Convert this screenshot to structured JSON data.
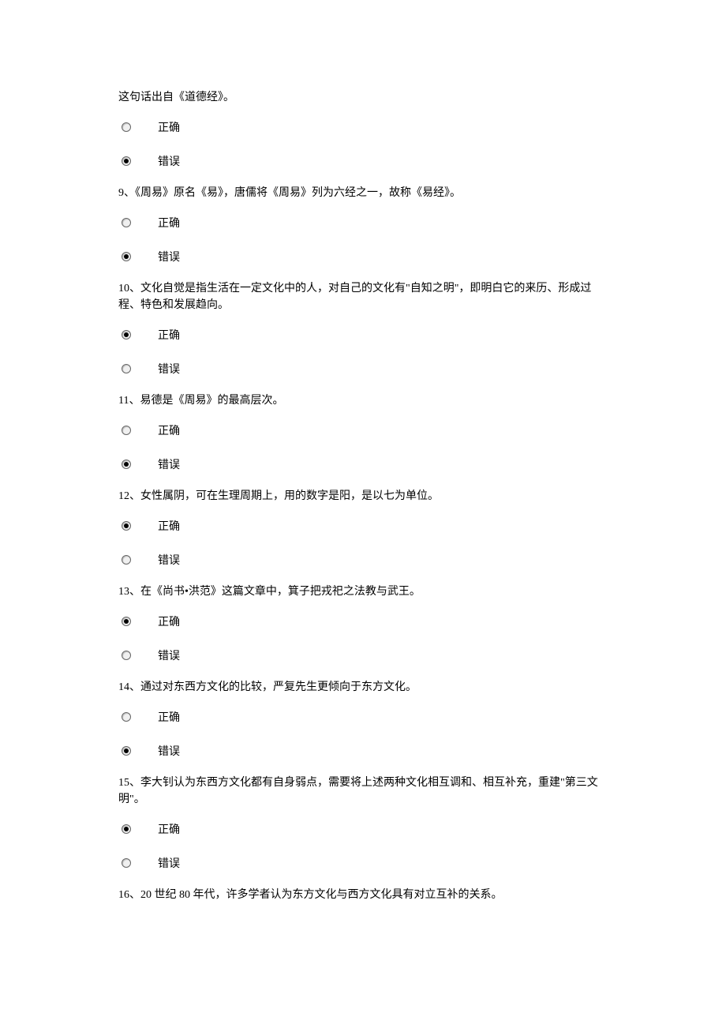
{
  "intro_text": "这句话出自《道德经》。",
  "labels": {
    "correct": "正确",
    "incorrect": "错误"
  },
  "questions": [
    {
      "id": "q8",
      "text": "",
      "selected": "incorrect"
    },
    {
      "id": "q9",
      "text": "9、《周易》原名《易》，唐儒将《周易》列为六经之一，故称《易经》。",
      "selected": "incorrect"
    },
    {
      "id": "q10",
      "text": "10、文化自觉是指生活在一定文化中的人，对自己的文化有\"自知之明\"，即明白它的来历、形成过程、特色和发展趋向。",
      "selected": "correct"
    },
    {
      "id": "q11",
      "text": "11、易德是《周易》的最高层次。",
      "selected": "incorrect"
    },
    {
      "id": "q12",
      "text": "12、女性属阴，可在生理周期上，用的数字是阳，是以七为单位。",
      "selected": "correct"
    },
    {
      "id": "q13",
      "text": "13、在《尚书•洪范》这篇文章中，箕子把戎祀之法教与武王。",
      "selected": "correct"
    },
    {
      "id": "q14",
      "text": "14、通过对东西方文化的比较，严复先生更倾向于东方文化。",
      "selected": "incorrect"
    },
    {
      "id": "q15",
      "text": "15、李大钊认为东西方文化都有自身弱点，需要将上述两种文化相互调和、相互补充，重建\"第三文明\"。",
      "selected": "correct"
    },
    {
      "id": "q16",
      "text": "16、20 世纪 80 年代，许多学者认为东方文化与西方文化具有对立互补的关系。",
      "selected": null
    }
  ]
}
